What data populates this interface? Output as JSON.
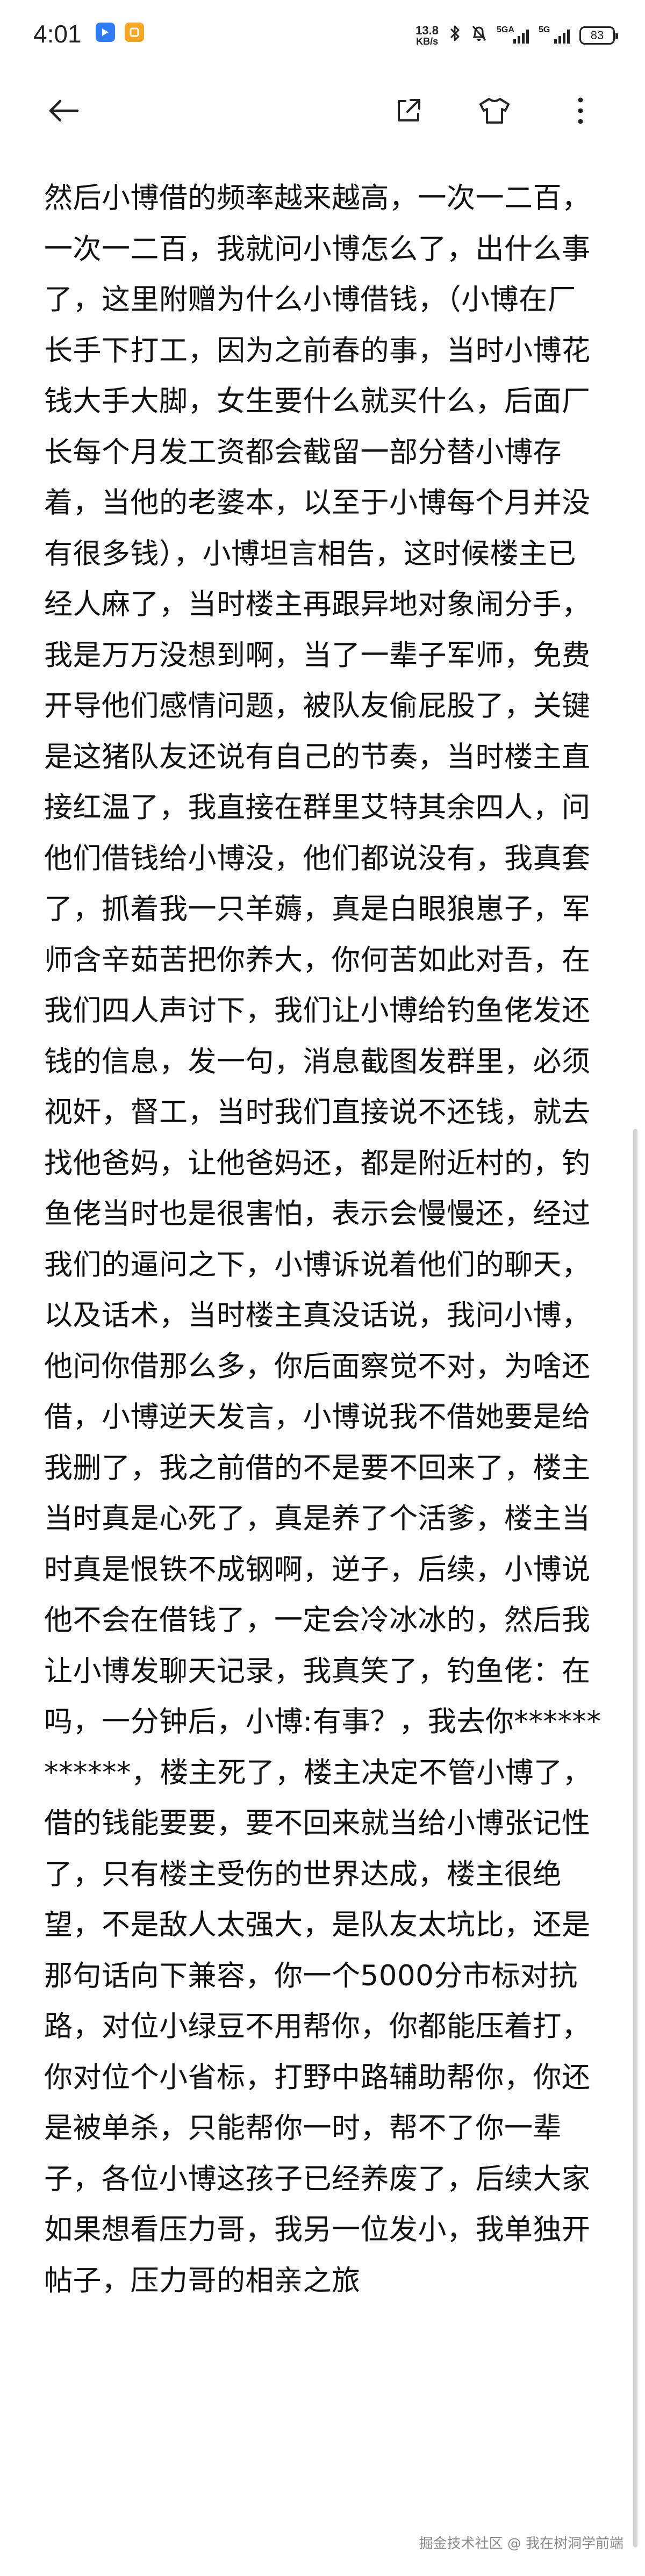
{
  "status_bar": {
    "time": "4:01",
    "app_badges": [
      {
        "icon": "blue-app-icon",
        "color": "#2f7cf6"
      },
      {
        "icon": "orange-app-icon",
        "color": "#f5a623"
      }
    ],
    "net_speed_value": "13.8",
    "net_speed_unit": "KB/s",
    "bluetooth_icon": "bluetooth-icon",
    "mute_icon": "bell-muted-icon",
    "signal_1_label": "5GA",
    "signal_2_label": "5G",
    "battery_level": "83"
  },
  "toolbar": {
    "back_icon": "arrow-left-icon",
    "share_icon": "share-external-icon",
    "theme_icon": "tshirt-icon",
    "more_icon": "more-vertical-icon"
  },
  "article": {
    "text": "然后小博借的频率越来越高，一次一二百，一次一二百，我就问小博怎么了，出什么事了，这里附赠为什么小博借钱，（小博在厂长手下打工，因为之前春的事，当时小博花钱大手大脚，女生要什么就买什么，后面厂长每个月发工资都会截留一部分替小博存着，当他的老婆本，以至于小博每个月并没有很多钱），小博坦言相告，这时候楼主已经人麻了，当时楼主再跟异地对象闹分手，我是万万没想到啊，当了一辈子军师，免费开导他们感情问题，被队友偷屁股了，关键是这猪队友还说有自己的节奏，当时楼主直接红温了，我直接在群里艾特其余四人，问他们借钱给小博没，他们都说没有，我真套了，抓着我一只羊薅，真是白眼狼崽子，军师含辛茹苦把你养大，你何苦如此对吾，在我们四人声讨下，我们让小博给钓鱼佬发还钱的信息，发一句，消息截图发群里，必须视奸，督工，当时我们直接说不还钱，就去找他爸妈，让他爸妈还，都是附近村的，钓鱼佬当时也是很害怕，表示会慢慢还，经过我们的逼问之下，小博诉说着他们的聊天，以及话术，当时楼主真没话说，我问小博，他问你借那么多，你后面察觉不对，为啥还借，小博逆天发言，小博说我不借她要是给我删了，我之前借的不是要不回来了，楼主当时真是心死了，真是养了个活爹，楼主当时真是恨铁不成钢啊，逆子，后续，小博说他不会在借钱了，一定会冷冰冰的，然后我让小博发聊天记录，我真笑了，钓鱼佬：在吗，一分钟后，小博:有事？，我去你************，楼主死了，楼主决定不管小博了，借的钱能要要，要不回来就当给小博张记性了，只有楼主受伤的世界达成，楼主很绝望，不是敌人太强大，是队友太坑比，还是那句话向下兼容，你一个5000分市标对抗路，对位小绿豆不用帮你，你都能压着打，你对位个小省标，打野中路辅助帮你，你还是被单杀，只能帮你一时，帮不了你一辈子，各位小博这孩子已经养废了，后续大家如果想看压力哥，我另一位发小，我单独开帖子，压力哥的相亲之旅"
  },
  "footer": {
    "watermark": "掘金技术社区 @ 我在树洞学前端"
  }
}
